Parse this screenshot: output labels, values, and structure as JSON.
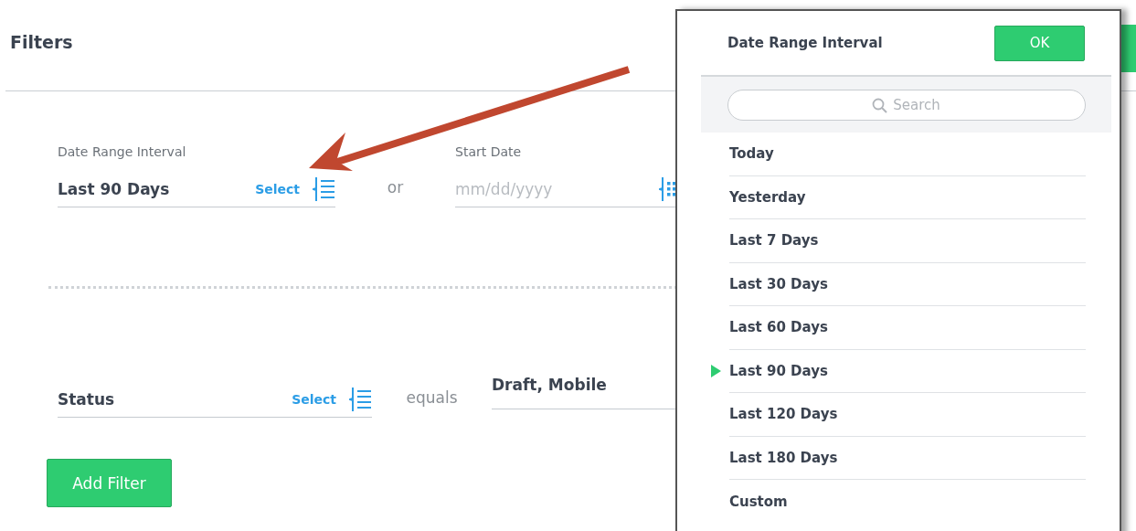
{
  "page": {
    "title": "Filters"
  },
  "date_filter": {
    "label": "Date Range Interval",
    "value": "Last 90 Days",
    "select_link": "Select",
    "separator": "or",
    "start_label": "Start Date",
    "start_placeholder": "mm/dd/yyyy"
  },
  "status_filter": {
    "label": "Status",
    "select_link": "Select",
    "operator": "equals",
    "value": "Draft, Mobile"
  },
  "add_filter_button": "Add Filter",
  "popup": {
    "title": "Date Range Interval",
    "ok_button": "OK",
    "search": {
      "placeholder": "Search"
    },
    "items": [
      {
        "label": "Today",
        "selected": false
      },
      {
        "label": "Yesterday",
        "selected": false
      },
      {
        "label": "Last 7 Days",
        "selected": false
      },
      {
        "label": "Last 30 Days",
        "selected": false
      },
      {
        "label": "Last 60 Days",
        "selected": false
      },
      {
        "label": "Last 90 Days",
        "selected": true
      },
      {
        "label": "Last 120 Days",
        "selected": false
      },
      {
        "label": "Last 180 Days",
        "selected": false
      },
      {
        "label": "Custom",
        "selected": false
      }
    ]
  }
}
